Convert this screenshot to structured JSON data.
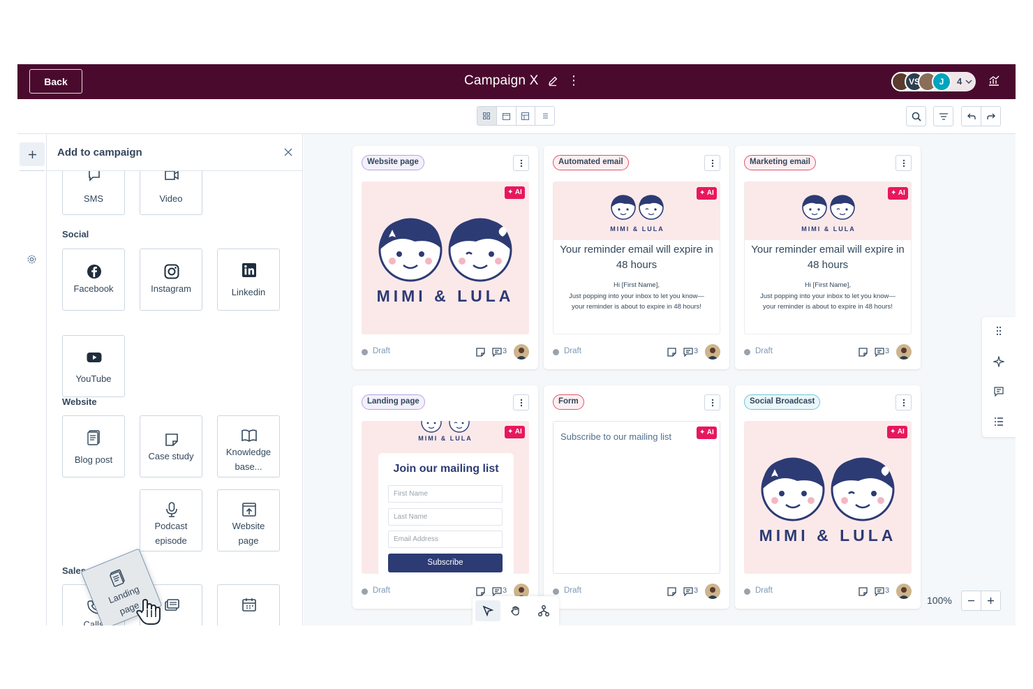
{
  "header": {
    "back_label": "Back",
    "title": "Campaign X",
    "collaborators": [
      {
        "initials": "",
        "color": "#5a3b2e"
      },
      {
        "initials": "VS",
        "color": "#2d3e50"
      },
      {
        "initials": "",
        "color": "#8a6e5a"
      },
      {
        "initials": "J",
        "color": "#00a4bd"
      }
    ],
    "collaborator_count": "4"
  },
  "panel": {
    "title": "Add to campaign",
    "top_tiles": [
      {
        "label": "SMS",
        "icon": "sms-icon"
      },
      {
        "label": "Video",
        "icon": "video-icon"
      }
    ],
    "social": {
      "label": "Social",
      "tiles": [
        {
          "label": "Facebook",
          "icon": "facebook-icon"
        },
        {
          "label": "Instagram",
          "icon": "instagram-icon"
        },
        {
          "label": "Linkedin",
          "icon": "linkedin-icon"
        },
        {
          "label": "YouTube",
          "icon": "youtube-icon"
        }
      ]
    },
    "website": {
      "label": "Website",
      "tiles": [
        {
          "label": "Blog post",
          "icon": "blog-post-icon"
        },
        {
          "label": "Case study",
          "icon": "case-study-icon"
        },
        {
          "label": "Knowledge base...",
          "icon": "knowledge-base-icon"
        },
        {
          "label": "Landing page",
          "icon": "landing-page-icon"
        },
        {
          "label": "Podcast episode",
          "icon": "podcast-icon"
        },
        {
          "label": "Website page",
          "icon": "website-page-icon"
        }
      ]
    },
    "sales": {
      "label": "Sales",
      "tiles": [
        {
          "label": "Calls",
          "icon": "phone-icon"
        },
        {
          "label": "",
          "icon": "sequence-icon"
        },
        {
          "label": "",
          "icon": "meetings-icon"
        }
      ]
    }
  },
  "cards": [
    {
      "type": "Website page",
      "pill_color": "#b3a5e0",
      "pill_bg": "#f3f0fc",
      "status": "Draft",
      "comments": "3",
      "ai": "AI",
      "brand": "MIMI & LULA"
    },
    {
      "type": "Automated email",
      "pill_color": "#e0536f",
      "pill_bg": "#fdeff1",
      "status": "Draft",
      "comments": "3",
      "ai": "AI",
      "brand": "MIMI & LULA",
      "email_title": "Your reminder email will expire in 48 hours",
      "email_greeting": "Hi [First Name],",
      "email_body": "Just popping into your inbox to let you know—your reminder is about to expire in 48 hours!"
    },
    {
      "type": "Marketing email",
      "pill_color": "#e0536f",
      "pill_bg": "#fdeff1",
      "status": "Draft",
      "comments": "3",
      "ai": "AI",
      "brand": "MIMI & LULA",
      "email_title": "Your reminder email will expire in 48 hours",
      "email_greeting": "Hi [First Name],",
      "email_body": "Just popping into your inbox to let you know—your reminder is about to expire in 48 hours!"
    },
    {
      "type": "Landing page",
      "pill_color": "#b3a5e0",
      "pill_bg": "#f3f0fc",
      "status": "Draft",
      "comments": "3",
      "ai": "AI",
      "brand": "MIMI & LULA",
      "form_title": "Join our mailing list",
      "fields": [
        "First Name",
        "Last Name",
        "Email Address"
      ],
      "button": "Subscribe"
    },
    {
      "type": "Form",
      "pill_color": "#e0536f",
      "pill_bg": "#fdeff1",
      "status": "Draft",
      "comments": "3",
      "ai": "AI",
      "form_text": "Subscribe to our mailing list"
    },
    {
      "type": "Social Broadcast",
      "pill_color": "#6fc4d6",
      "pill_bg": "#eaf7fa",
      "status": "Draft",
      "comments": "3",
      "ai": "AI",
      "brand": "MIMI & LULA"
    }
  ],
  "zoom": {
    "level": "100%"
  },
  "colors": {
    "header_bg": "#4a0a2e",
    "ai_badge": "#e8175d",
    "brand_navy": "#2d3b74",
    "preview_pink": "#fbe9ea"
  }
}
